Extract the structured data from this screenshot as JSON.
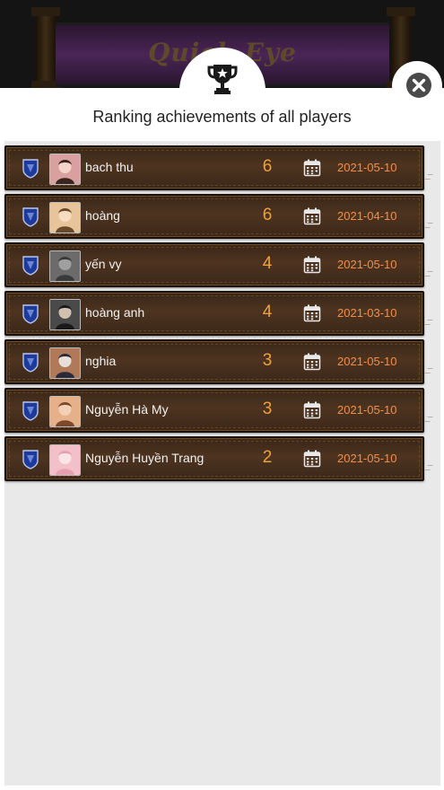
{
  "game": {
    "title": "Quick Eye"
  },
  "modal": {
    "title": "Ranking achievements of all players",
    "header_icon": "trophy-icon",
    "close_icon": "close-icon"
  },
  "colors": {
    "row_wood": "#4e3420",
    "score": "#f0a13a",
    "date": "#ef8f4e",
    "name": "#f1f1f1",
    "badge": "#1e3a9a"
  },
  "rankings": [
    {
      "name": "bach thu",
      "score": "6",
      "date": "2021-05-10",
      "avatar": "avatar-photo"
    },
    {
      "name": "hoàng",
      "score": "6",
      "date": "2021-04-10",
      "avatar": "avatar-photo"
    },
    {
      "name": "yến vy",
      "score": "4",
      "date": "2021-05-10",
      "avatar": "avatar-photo"
    },
    {
      "name": "hoàng anh",
      "score": "4",
      "date": "2021-03-10",
      "avatar": "avatar-photo"
    },
    {
      "name": "nghia",
      "score": "3",
      "date": "2021-05-10",
      "avatar": "avatar-photo"
    },
    {
      "name": "Nguyễn Hà My",
      "score": "3",
      "date": "2021-05-10",
      "avatar": "avatar-photo"
    },
    {
      "name": "Nguyễn Huyền Trang",
      "score": "2",
      "date": "2021-05-10",
      "avatar": "avatar-photo"
    }
  ]
}
